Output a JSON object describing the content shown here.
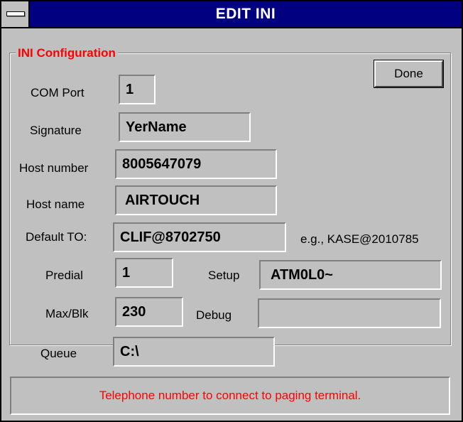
{
  "window": {
    "title": "EDIT INI"
  },
  "group": {
    "title": "INI Configuration"
  },
  "buttons": {
    "done": "Done"
  },
  "fields": {
    "com_port": {
      "label": "COM Port",
      "value": "1"
    },
    "signature": {
      "label": "Signature",
      "value": "YerName"
    },
    "host_number": {
      "label": "Host number",
      "value": "8005647079"
    },
    "host_name": {
      "label": "Host name",
      "value": "AIRTOUCH"
    },
    "default_to": {
      "label": "Default TO:",
      "value": "CLIF@8702750",
      "hint": "e.g., KASE@2010785"
    },
    "predial": {
      "label": "Predial",
      "value": "1"
    },
    "setup": {
      "label": "Setup",
      "value": "ATM0L0~"
    },
    "max_blk": {
      "label": "Max/Blk",
      "value": "230"
    },
    "debug": {
      "label": "Debug",
      "value": ""
    },
    "queue": {
      "label": "Queue",
      "value": "C:\\"
    }
  },
  "status": {
    "message": "Telephone number to connect to paging terminal."
  },
  "colors": {
    "title_bar": "#000080",
    "face": "#c0c0c0",
    "accent_text": "#ff0000"
  },
  "icons": {
    "system_menu": "system-menu-icon"
  }
}
